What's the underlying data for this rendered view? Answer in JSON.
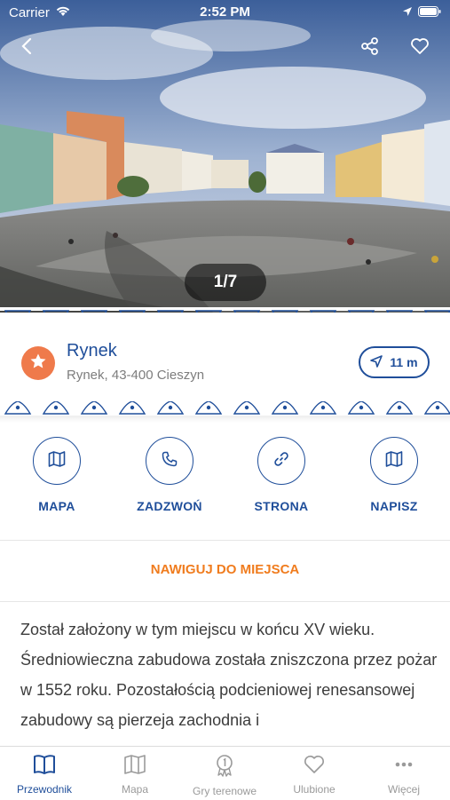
{
  "status_bar": {
    "carrier": "Carrier",
    "time": "2:52 PM"
  },
  "hero": {
    "pager": "1/7"
  },
  "place": {
    "title": "Rynek",
    "address": "Rynek, 43-400 Cieszyn",
    "distance": "11 m"
  },
  "actions": [
    {
      "label": "MAPA",
      "icon": "map-icon"
    },
    {
      "label": "ZADZWOŃ",
      "icon": "phone-icon"
    },
    {
      "label": "STRONA",
      "icon": "link-icon"
    },
    {
      "label": "NAPISZ",
      "icon": "map-icon"
    }
  ],
  "navigate_label": "NAWIGUJ DO MIEJSCA",
  "description": "Został założony w tym miejscu w końcu XV wieku. Średniowieczna zabudowa została zniszczona przez pożar w 1552 roku. Pozostałością podcieniowej renesansowej zabudowy są pierzeja zachodnia i",
  "tabs": [
    {
      "label": "Przewodnik",
      "icon": "book-icon",
      "active": true
    },
    {
      "label": "Mapa",
      "icon": "map-icon"
    },
    {
      "label": "Gry terenowe",
      "icon": "medal-icon"
    },
    {
      "label": "Ulubione",
      "icon": "heart-icon"
    },
    {
      "label": "Więcej",
      "icon": "more-icon"
    }
  ],
  "colors": {
    "primary": "#1f4e9a",
    "accent": "#ef7a4b",
    "navigate": "#f07c1e"
  }
}
